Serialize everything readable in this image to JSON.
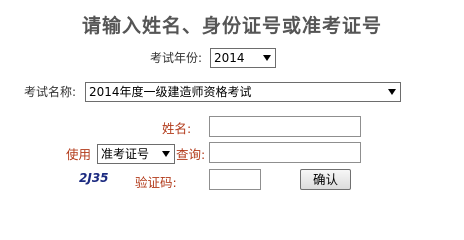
{
  "title": "请输入姓名、身份证号或准考证号",
  "year": {
    "label": "考试年份:",
    "selected": "2014"
  },
  "exam": {
    "label": "考试名称:",
    "selected": "2014年度一级建造师资格考试"
  },
  "name": {
    "label": "姓名:",
    "value": ""
  },
  "query": {
    "prefix": "使用",
    "selected": "准考证号",
    "suffix": "查询:",
    "value": ""
  },
  "captcha": {
    "image_text": "2J35",
    "label": "验证码:",
    "value": ""
  },
  "confirm_label": "确认"
}
